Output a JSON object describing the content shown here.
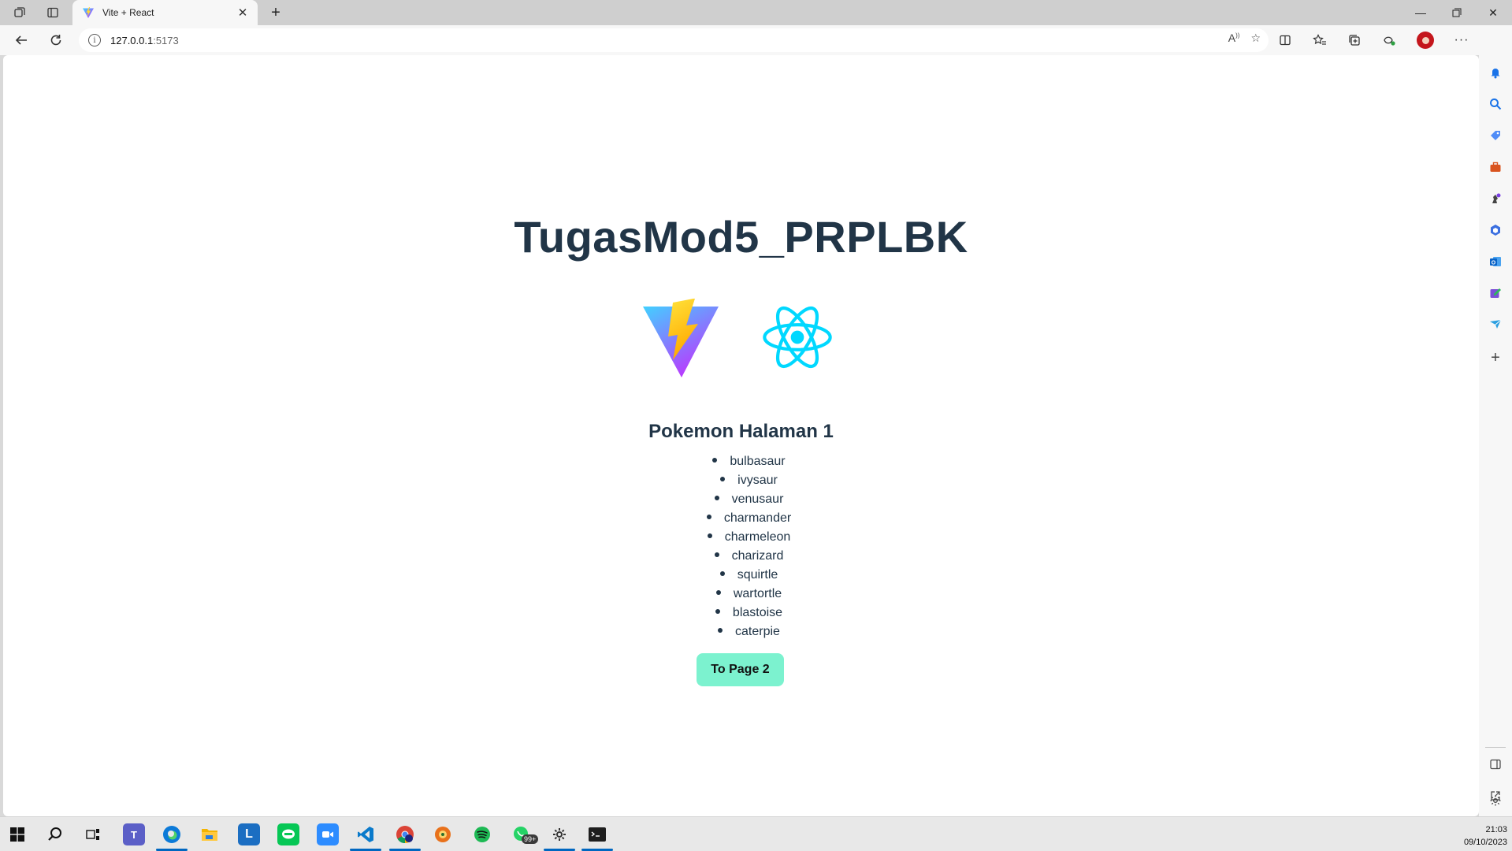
{
  "browser": {
    "tab_title": "Vite + React",
    "url_host": "127.0.0.1",
    "url_port": ":5173"
  },
  "page": {
    "title": "TugasMod5_PRPLBK",
    "section_title": "Pokemon Halaman 1",
    "pokemon": [
      "bulbasaur",
      "ivysaur",
      "venusaur",
      "charmander",
      "charmeleon",
      "charizard",
      "squirtle",
      "wartortle",
      "blastoise",
      "caterpie"
    ],
    "button_label": "To Page 2",
    "button_color": "#7cf2cf",
    "text_color": "#213547"
  },
  "taskbar": {
    "notification_badge": "99+",
    "time": "21:03",
    "date": "09/10/2023"
  },
  "icons": [
    "workspaces-icon",
    "tab-actions-icon",
    "back-icon",
    "refresh-icon",
    "read-aloud-icon",
    "favorite-star-icon",
    "split-screen-icon",
    "favorites-icon",
    "collections-icon",
    "extensions-icon",
    "profile-avatar",
    "more-icon",
    "bing-copilot-icon"
  ]
}
